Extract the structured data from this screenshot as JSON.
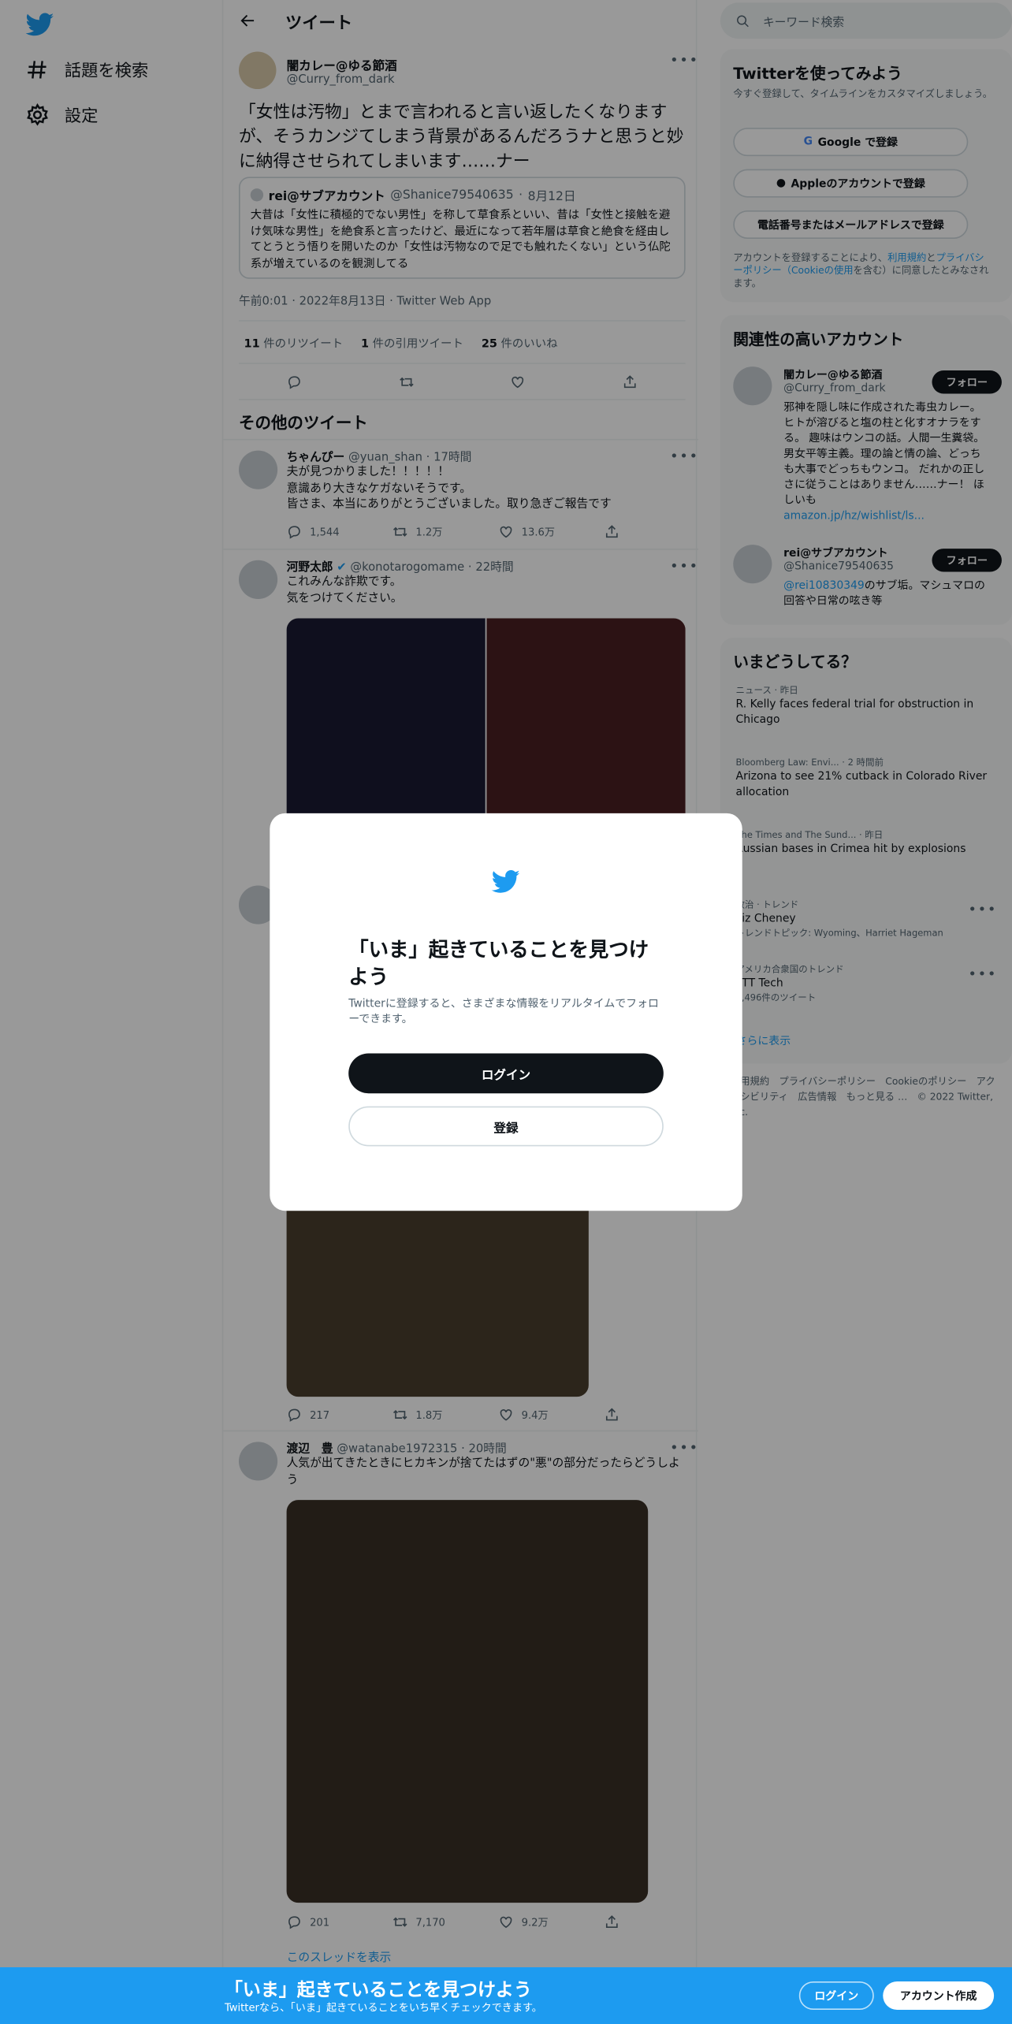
{
  "colors": {
    "brand": "#1d9bf0",
    "text": "#0f1419",
    "muted": "#536471",
    "overlay": "rgba(0,0,0,0.4)"
  },
  "nav": {
    "explore_label": "話題を検索",
    "settings_label": "設定",
    "logo_icon": "twitter-bird-icon"
  },
  "header": {
    "title": "ツイート"
  },
  "main_tweet": {
    "author_name": "闇カレー@ゆる節酒",
    "author_handle": "@Curry_from_dark",
    "text": "「女性は汚物」とまで言われると言い返したくなりますが、そうカンジてしまう背景があるんだろうナと思うと妙に納得させられてしまいます……ナー",
    "quote": {
      "author_name": "rei@サブアカウント",
      "author_handle": "@Shanice79540635",
      "date": "8月12日",
      "text": "大昔は「女性に積極的でない男性」を称して草食系といい、昔は「女性と接触を避け気味な男性」を絶食系と言ったけど、最近になって若年層は草食と絶食を経由してとうとう悟りを開いたのか「女性は汚物なので足でも触れたくない」という仏陀系が増えているのを観測してる"
    },
    "meta": "午前0:01 · 2022年8月13日 · Twitter Web App",
    "retweets": "11",
    "retweets_label": "件のリツイート",
    "quotes": "1",
    "quotes_label": "件の引用ツイート",
    "likes": "25",
    "likes_label": "件のいいね"
  },
  "more_tweets_header": "その他のツイート",
  "tweets": [
    {
      "name": "ちゃんぴー",
      "handle": "@yuan_shan",
      "time": "17時間",
      "text": "夫が見つかりました！！！！！\n意識あり大きなケガないそうです。\n皆さま、本当にありがとうございました。取り急ぎご報告です",
      "replies": "1,544",
      "retweets": "1.2万",
      "likes": "13.6万"
    },
    {
      "name": "河野太郎",
      "handle": "@konotarogomame",
      "time": "22時間",
      "text": "これみんな詐欺です。\n気をつけてください。",
      "replies": "217",
      "retweets": "1.8万",
      "likes": "9.4万"
    },
    {
      "name": "渡辺　豊",
      "handle": "@watanabe1972315",
      "time": "20時間",
      "text": "人気が出てきたときにヒカキンが捨てたはずの\"悪\"の部分だったらどうしよう",
      "replies": "201",
      "retweets": "7,170",
      "likes": "9.2万"
    }
  ],
  "show_thread": "このスレッドを表示",
  "search": {
    "placeholder": "キーワード検索"
  },
  "signup_card": {
    "title": "Twitterを使ってみよう",
    "subtitle": "今すぐ登録して、タイムラインをカスタマイズしましょう。",
    "google": "Google で登録",
    "apple": "Appleのアカウントで登録",
    "phone": "電話番号またはメールアドレスで登録",
    "terms_prefix": "アカウントを登録することにより、",
    "terms_link1": "利用規約",
    "terms_and": "と",
    "terms_link2": "プライバシーポリシー（Cookieの使用",
    "terms_suffix": "を含む）に同意したとみなされます。"
  },
  "relevant": {
    "title": "関連性の高いアカウント",
    "follow_label": "フォロー",
    "accounts": [
      {
        "name": "闇カレー@ゆる節酒",
        "handle": "@Curry_from_dark",
        "bio": "邪神を隠し味に作成された毒虫カレー。 ヒトが溶びると塩の柱と化すオナラをする。 趣味はウンコの話。人間一生糞袋。男女平等主義。理の論と情の論、どっちも大事でどっちもウンコ。 だれかの正しさに従うことはありません……ナー！ ほしいも",
        "link": "amazon.jp/hz/wishlist/ls..."
      },
      {
        "name": "rei@サブアカウント",
        "handle": "@Shanice79540635",
        "bio_link": "@rei10830349",
        "bio": "のサブ垢。マシュマロの回答や日常の呟き等"
      }
    ]
  },
  "trends": {
    "title": "いまどうしてる？",
    "items": [
      {
        "meta": "ニュース · 昨日",
        "title": "R. Kelly faces federal trial for obstruction in Chicago"
      },
      {
        "meta": "Bloomberg Law: Envi... · 2 時間前",
        "title": "Arizona to see 21% cutback in Colorado River allocation"
      },
      {
        "meta": "The Times and The Sund... · 昨日",
        "title": "Russian bases in Crimea hit by explosions"
      },
      {
        "meta": "政治 · トレンド",
        "title": "Liz Cheney",
        "extra": "トレンドトピック: Wyoming、Harriet Hageman"
      },
      {
        "meta": "アメリカ合衆国のトレンド",
        "title": "FTT Tech",
        "extra": "2,496件のツイート"
      }
    ],
    "show_more": "さらに表示"
  },
  "footer": {
    "links": "利用規約　プライバシーポリシー　Cookieのポリシー　アクセシビリティ　広告情報　もっと見る …　© 2022 Twitter, Inc."
  },
  "modal": {
    "title": "「いま」起きていることを見つけよう",
    "subtitle": "Twitterに登録すると、さまざまな情報をリアルタイムでフォローできます。",
    "login": "ログイン",
    "signup": "登録"
  },
  "bottom_bar": {
    "title": "「いま」起きていることを見つけよう",
    "subtitle": "Twitterなら、「いま」起きていることをいち早くチェックできます。",
    "login": "ログイン",
    "signup": "アカウント作成"
  }
}
